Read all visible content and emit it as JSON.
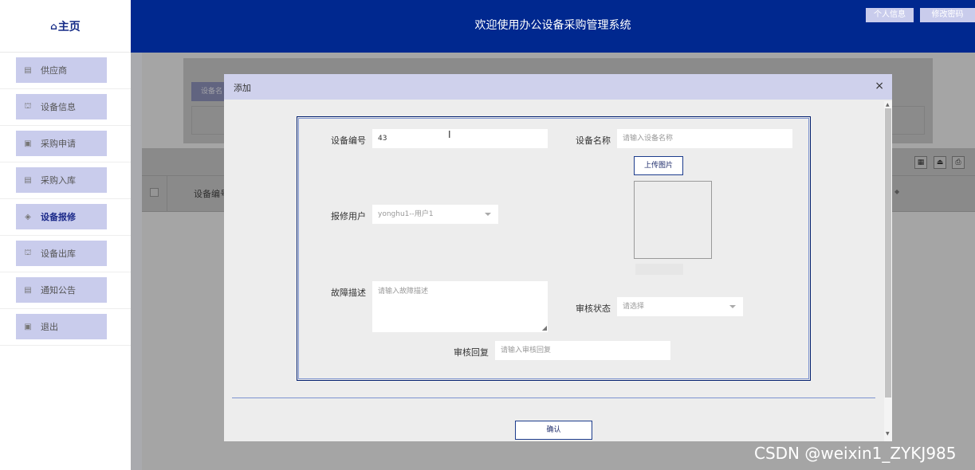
{
  "sidebar": {
    "home_label": "主页",
    "home_icon": "⌂",
    "items": [
      {
        "label": "供应商",
        "icon": "list-icon",
        "active": false
      },
      {
        "label": "设备信息",
        "icon": "building-icon",
        "active": false
      },
      {
        "label": "采购申请",
        "icon": "document-icon",
        "active": false
      },
      {
        "label": "采购入库",
        "icon": "list-icon",
        "active": false
      },
      {
        "label": "设备报修",
        "icon": "layers-icon",
        "active": true
      },
      {
        "label": "设备出库",
        "icon": "building-icon",
        "active": false
      },
      {
        "label": "通知公告",
        "icon": "list-icon",
        "active": false
      },
      {
        "label": "退出",
        "icon": "document-icon",
        "active": false
      }
    ]
  },
  "header": {
    "title": "欢迎使用办公设备采购管理系统",
    "profile_button": "个人信息",
    "password_button": "修改密码"
  },
  "background": {
    "search_button": "设备名",
    "table_col1": "设备编号"
  },
  "modal": {
    "title": "添加",
    "close": "×",
    "fields": {
      "device_no_label": "设备编号",
      "device_no_value": "43",
      "device_name_label": "设备名称",
      "device_name_placeholder": "请输入设备名称",
      "upload_label": "上传图片",
      "repair_user_label": "报修用户",
      "repair_user_value": "yonghu1--用户1",
      "fault_desc_label": "故障描述",
      "fault_desc_placeholder": "请输入故障描述",
      "review_status_label": "审核状态",
      "review_status_placeholder": "请选择",
      "review_reply_label": "审核回复",
      "review_reply_placeholder": "请输入审核回复"
    },
    "confirm_label": "确认"
  },
  "watermark": "CSDN @weixin1_ZYKJ985",
  "colors": {
    "header_bg": "#00288f",
    "sidebar_button": "#c9ccec",
    "modal_header": "#cfd1ec",
    "form_border": "#001e6e"
  }
}
